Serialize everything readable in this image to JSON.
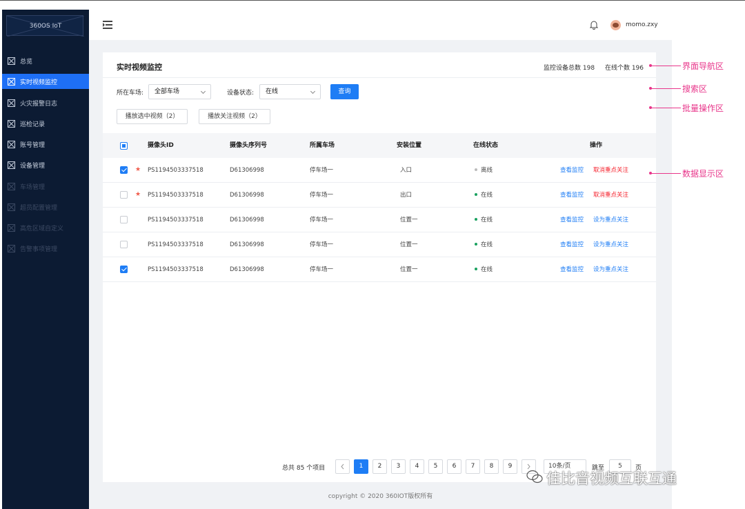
{
  "app": {
    "logo_text": "360OS IoT"
  },
  "sidebar": {
    "items": [
      {
        "label": "总览",
        "state": "normal"
      },
      {
        "label": "实时视频监控",
        "state": "active"
      },
      {
        "label": "火灾报警日志",
        "state": "normal"
      },
      {
        "label": "巡检记录",
        "state": "normal"
      },
      {
        "label": "账号管理",
        "state": "normal"
      },
      {
        "label": "设备管理",
        "state": "normal"
      },
      {
        "label": "车场管理",
        "state": "disabled"
      },
      {
        "label": "超员配置管理",
        "state": "disabled"
      },
      {
        "label": "高危区域自定义",
        "state": "disabled"
      },
      {
        "label": "告警事项管理",
        "state": "disabled"
      }
    ]
  },
  "header": {
    "username": "momo.zxy"
  },
  "page": {
    "title": "实时视频监控",
    "stats_total": "监控设备总数 198",
    "stats_online": "在线个数 196"
  },
  "search": {
    "lot_label": "所在车场:",
    "lot_value": "全部车场",
    "status_label": "设备状态:",
    "status_value": "在线",
    "query_button": "查询"
  },
  "batch": {
    "play_selected": "播放选中视频（2）",
    "play_followed": "播放关注视频（2）"
  },
  "table": {
    "headers": [
      "摄像头ID",
      "摄像头序列号",
      "所属车场",
      "安装位置",
      "在线状态",
      "操作"
    ],
    "view_action": "查看监控",
    "rows": [
      {
        "checked": true,
        "starred": true,
        "id": "PS1194503337518",
        "serial": "D61306998",
        "lot": "停车场一",
        "location": "入口",
        "status": "离线",
        "status_color": "#bbbbbb",
        "follow_action": "取消重点关注",
        "follow_type": "cancel"
      },
      {
        "checked": false,
        "starred": true,
        "id": "PS1194503337518",
        "serial": "D61306998",
        "lot": "停车场一",
        "location": "出口",
        "status": "在线",
        "status_color": "#19a15f",
        "follow_action": "取消重点关注",
        "follow_type": "cancel"
      },
      {
        "checked": false,
        "starred": false,
        "id": "PS1194503337518",
        "serial": "D61306998",
        "lot": "停车场一",
        "location": "位置一",
        "status": "在线",
        "status_color": "#19a15f",
        "follow_action": "设为重点关注",
        "follow_type": "set"
      },
      {
        "checked": false,
        "starred": false,
        "id": "PS1194503337518",
        "serial": "D61306998",
        "lot": "停车场一",
        "location": "位置一",
        "status": "在线",
        "status_color": "#19a15f",
        "follow_action": "设为重点关注",
        "follow_type": "set"
      },
      {
        "checked": true,
        "starred": false,
        "id": "PS1194503337518",
        "serial": "D61306998",
        "lot": "停车场一",
        "location": "位置一",
        "status": "在线",
        "status_color": "#19a15f",
        "follow_action": "设为重点关注",
        "follow_type": "set"
      }
    ]
  },
  "pagination": {
    "total": "总共 85 个项目",
    "pages": [
      "1",
      "2",
      "3",
      "4",
      "5",
      "6",
      "7",
      "8",
      "9"
    ],
    "current": "1",
    "page_size": "10条/页",
    "jump_label": "跳至",
    "jump_value": "5",
    "page_suffix": "页"
  },
  "footer": {
    "copyright": "copyright © 2020 360IOT版权所有"
  },
  "annotations": {
    "nav": "界面导航区",
    "search": "搜索区",
    "batch": "批量操作区",
    "data": "数据显示区"
  },
  "watermark": "佳比音视频互联互通",
  "colors": {
    "accent": "#1e7df5",
    "sidebar_bg": "#0c1b33",
    "danger": "#f5222d",
    "annotation": "#e8358a"
  }
}
